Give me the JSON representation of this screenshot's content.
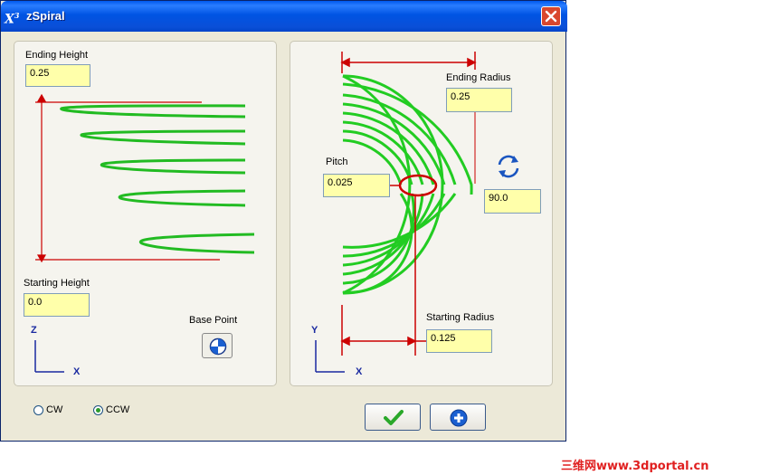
{
  "window": {
    "title": "zSpiral",
    "app_icon_text": "X",
    "app_icon_sup": "3"
  },
  "left_panel": {
    "ending_height": {
      "label": "Ending Height",
      "value": "0.25"
    },
    "starting_height": {
      "label": "Starting Height",
      "value": "0.0"
    },
    "base_point_label": "Base Point",
    "axis_vertical": "Z",
    "axis_horizontal": "X"
  },
  "right_panel": {
    "ending_radius": {
      "label": "Ending Radius",
      "value": "0.25"
    },
    "pitch": {
      "label": "Pitch",
      "value": "0.025"
    },
    "angle": {
      "value": "90.0"
    },
    "starting_radius": {
      "label": "Starting Radius",
      "value": "0.125"
    },
    "axis_vertical": "Y",
    "axis_horizontal": "X"
  },
  "direction": {
    "options": [
      "CW",
      "CCW"
    ],
    "selected": "CCW"
  },
  "buttons": {
    "ok_icon": "checkmark-icon",
    "apply_icon": "plus-icon"
  },
  "colors": {
    "field_bg": "#ffffaa",
    "spiral": "#33cc33",
    "dimension": "#cc0000"
  },
  "watermark": "三维网www.3dportal.cn"
}
